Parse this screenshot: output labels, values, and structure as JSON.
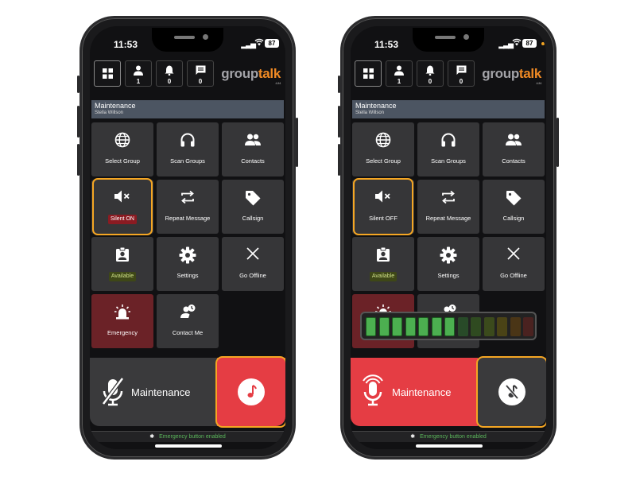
{
  "left_phone": {
    "status": {
      "time": "11:53",
      "battery": "87"
    },
    "header": {
      "grid_label": "",
      "counts": {
        "contacts": "1",
        "alerts": "0",
        "messages": "0"
      },
      "logo_group": "group",
      "logo_talk": "talk",
      "logo_version": "4.34"
    },
    "group_bar": {
      "name": "Maintenance",
      "user": "Stella Willson"
    },
    "tiles": {
      "select_group": "Select Group",
      "scan_groups": "Scan Groups",
      "contacts": "Contacts",
      "silent": "Silent ON",
      "repeat_message": "Repeat Message",
      "callsign": "Callsign",
      "available": "Available",
      "settings": "Settings",
      "go_offline": "Go Offline",
      "emergency": "Emergency",
      "contact_me": "Contact Me"
    },
    "ptt": {
      "label": "Maintenance"
    },
    "footer": {
      "emergency_text": "Emergency button enabled"
    }
  },
  "right_phone": {
    "status": {
      "time": "11:53",
      "battery": "87"
    },
    "header": {
      "counts": {
        "contacts": "1",
        "alerts": "0",
        "messages": "0"
      },
      "logo_group": "group",
      "logo_talk": "talk",
      "logo_version": "4.34"
    },
    "group_bar": {
      "name": "Maintenance",
      "user": "Stella Willson"
    },
    "tiles": {
      "select_group": "Select Group",
      "scan_groups": "Scan Groups",
      "contacts": "Contacts",
      "silent": "Silent OFF",
      "repeat_message": "Repeat Message",
      "callsign": "Callsign",
      "available": "Available",
      "settings": "Settings",
      "go_offline": "Go Offline"
    },
    "ptt": {
      "label": "Maintenance"
    },
    "footer": {
      "emergency_text": "Emergency button enabled"
    },
    "audio_meter": {
      "level_fraction": 0.54
    }
  },
  "colors": {
    "accent_orange": "#f5a623",
    "ptt_red": "#e53d44",
    "emergency_green": "#5cb85c"
  }
}
